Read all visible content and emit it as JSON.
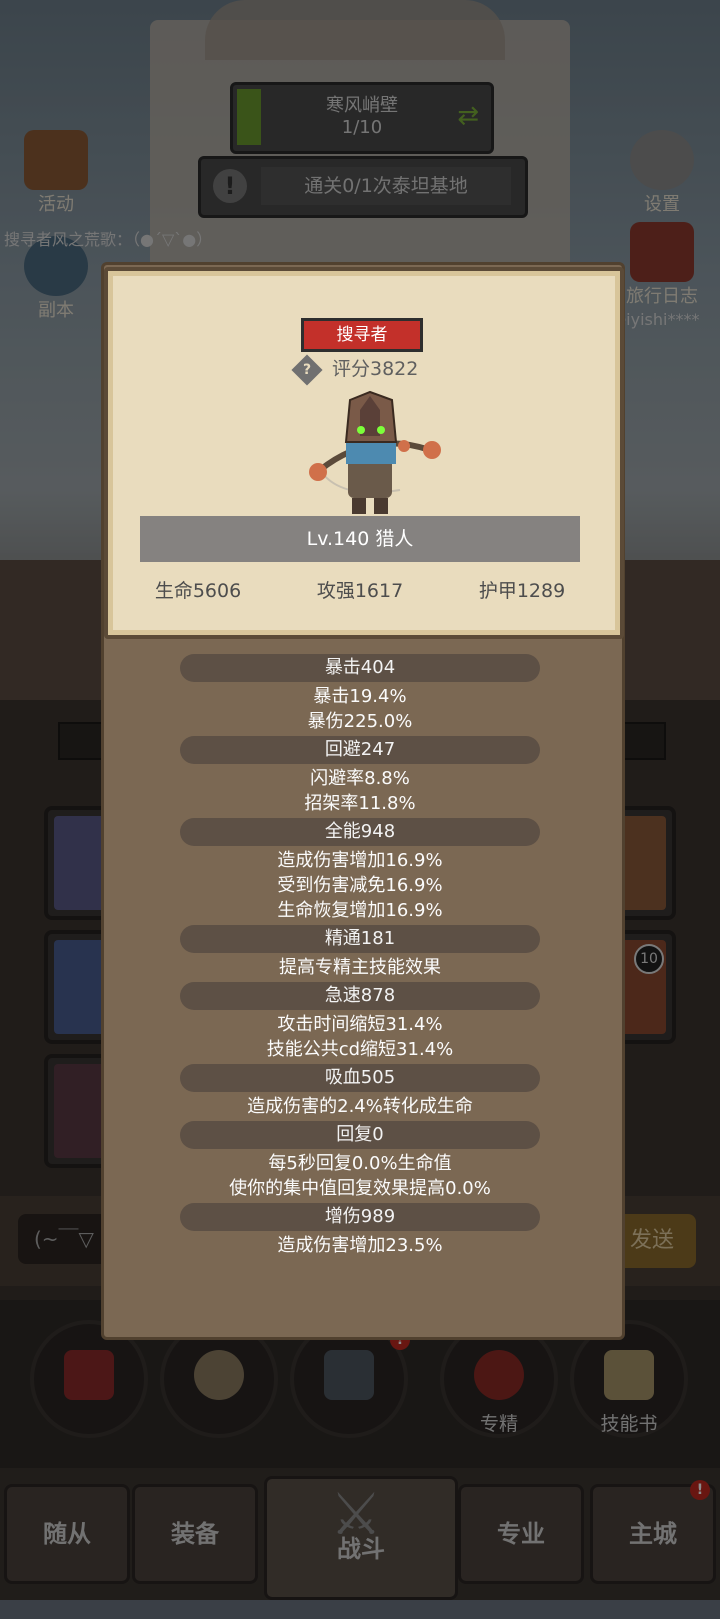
{
  "top": {
    "stage_name": "寒风峭壁",
    "stage_progress": "1/10",
    "quest": "通关0/1次泰坦基地",
    "notice": "搜寻者风之荒歌：（●´▽`●）",
    "user_name": "seiyishi****"
  },
  "side_buttons": {
    "activity": "活动",
    "settings": "设置",
    "dungeon": "副本",
    "journal": "旅行日志"
  },
  "popup": {
    "class_badge": "搜寻者",
    "score": "评分3822",
    "level": "Lv.140 猎人",
    "hp": "生命5606",
    "attack": "攻强1617",
    "armor": "护甲1289",
    "stats": [
      {
        "head": "暴击404",
        "lines": [
          "暴击19.4%",
          "暴伤225.0%"
        ]
      },
      {
        "head": "回避247",
        "lines": [
          "闪避率8.8%",
          "招架率11.8%"
        ]
      },
      {
        "head": "全能948",
        "lines": [
          "造成伤害增加16.9%",
          "受到伤害减免16.9%",
          "生命恢复增加16.9%"
        ]
      },
      {
        "head": "精通181",
        "lines": [
          "提高专精主技能效果"
        ]
      },
      {
        "head": "急速878",
        "lines": [
          "攻击时间缩短31.4%",
          "技能公共cd缩短31.4%"
        ]
      },
      {
        "head": "吸血505",
        "lines": [
          "造成伤害的2.4%转化成生命"
        ]
      },
      {
        "head": "回复0",
        "lines": [
          "每5秒回复0.0%生命值",
          "使你的集中值回复效果提高0.0%"
        ]
      },
      {
        "head": "增伤989",
        "lines": [
          "造成伤害增加23.5%"
        ]
      }
    ]
  },
  "chat": {
    "input_text": "(~￣▽",
    "send": "发送"
  },
  "slot_badge": "10",
  "circle_buttons": {
    "specialization": "专精",
    "skill_book": "技能书",
    "notice_mark": "!"
  },
  "tabs": {
    "follower": "随从",
    "equipment": "装备",
    "battle": "战斗",
    "profession": "专业",
    "main_city": "主城"
  },
  "colors": {
    "panel": "#7b6853",
    "card": "#e9dcbe",
    "badge_red": "#c3302a",
    "stat_head": "#5d5045"
  }
}
